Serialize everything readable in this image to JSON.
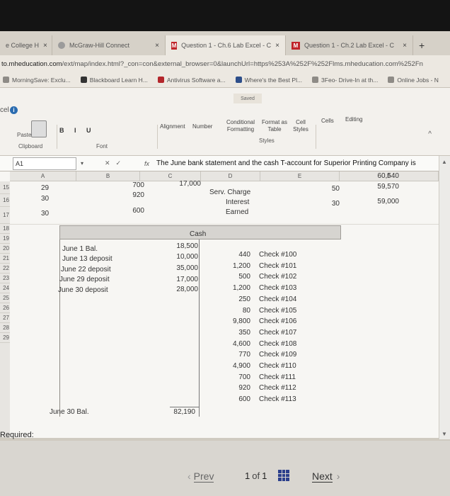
{
  "browser": {
    "tabs": [
      {
        "label": "e College H",
        "close": "×"
      },
      {
        "label": "McGraw-Hill Connect",
        "close": "×"
      },
      {
        "label": "Question 1 - Ch.6 Lab Excel - C",
        "close": "×"
      },
      {
        "label": "Question 1 - Ch.2 Lab Excel - C",
        "close": "×"
      }
    ],
    "new_tab": "+",
    "url_host": "to.mheducation.com",
    "url_path": "/ext/map/index.html?_con=con&external_browser=0&launchUrl=https%253A%252F%252Flms.mheducation.com%252Fn",
    "bookmarks": [
      "MorningSave: Exclu...",
      "Blackboard Learn H...",
      "Antivirus Software a...",
      "Where's the Best Pl...",
      "3Feo- Drive-In at th...",
      "Online Jobs - N"
    ]
  },
  "ribbon": {
    "saved": "Saved",
    "app": "cel",
    "paste": "Paste",
    "clipboard": "Clipboard",
    "font": "Font",
    "format_buttons": "B I U",
    "alignment": "Alignment",
    "number": "Number",
    "conditional": "Conditional Formatting",
    "format_table": "Format as Table",
    "cell_styles": "Cell Styles",
    "styles": "Styles",
    "cells": "Cells",
    "editing": "Editing",
    "collapse": "^"
  },
  "formula_bar": {
    "name_box": "A1",
    "fx": "fx",
    "content": "The June bank statement and the cash T-account for Superior Printing Company is"
  },
  "grid": {
    "columns": [
      "A",
      "B",
      "C",
      "D",
      "E",
      "F"
    ],
    "rows": [
      "15",
      "16",
      "17",
      "18",
      "19",
      "20",
      "21",
      "22",
      "23",
      "24",
      "25",
      "26",
      "27",
      "28",
      "29"
    ],
    "top_cells": {
      "a15": "29",
      "a16": "30",
      "a17": "30",
      "b15": "700",
      "b16": "920",
      "b17": "600",
      "c15": "17,000",
      "d15": "Serv. Charge",
      "d16": "Interest",
      "d17": "Earned",
      "e15": "50",
      "e16": "30",
      "f14": "60,540",
      "f15": "59,570",
      "f16": "59,000"
    },
    "t_account": {
      "title": "Cash",
      "debits": [
        {
          "label": "June 1 Bal.",
          "amount": "18,500"
        },
        {
          "label": "June 13 deposit",
          "amount": "10,000"
        },
        {
          "label": "June 22 deposit",
          "amount": "35,000"
        },
        {
          "label": "June 29 deposit",
          "amount": "17,000"
        },
        {
          "label": "June 30 deposit",
          "amount": "28,000"
        }
      ],
      "credits": [
        {
          "amount": "440",
          "label": "Check #100"
        },
        {
          "amount": "1,200",
          "label": "Check #101"
        },
        {
          "amount": "500",
          "label": "Check #102"
        },
        {
          "amount": "1,200",
          "label": "Check #103"
        },
        {
          "amount": "250",
          "label": "Check #104"
        },
        {
          "amount": "80",
          "label": "Check #105"
        },
        {
          "amount": "9,800",
          "label": "Check #106"
        },
        {
          "amount": "350",
          "label": "Check #107"
        },
        {
          "amount": "4,600",
          "label": "Check #108"
        },
        {
          "amount": "770",
          "label": "Check #109"
        },
        {
          "amount": "4,900",
          "label": "Check #110"
        },
        {
          "amount": "700",
          "label": "Check #111"
        },
        {
          "amount": "920",
          "label": "Check #112"
        },
        {
          "amount": "600",
          "label": "Check #113"
        }
      ],
      "ending_label": "June 30 Bal.",
      "ending_amount": "82,190"
    }
  },
  "required": "Required:",
  "pager": {
    "prev": "Prev",
    "current": "1",
    "of": "of",
    "total": "1",
    "next": "Next"
  }
}
